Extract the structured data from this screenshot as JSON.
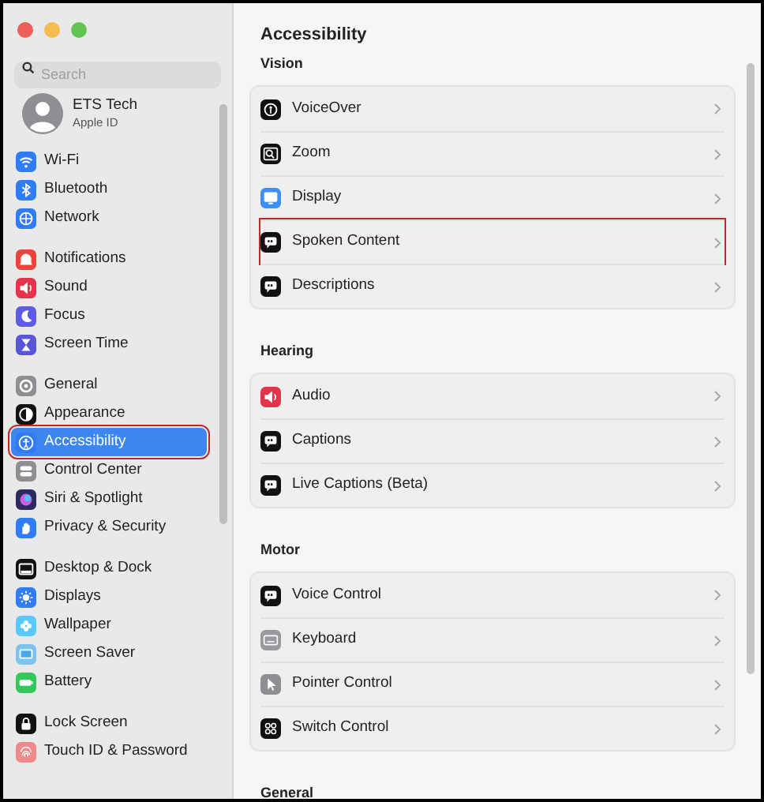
{
  "sidebar": {
    "search": {
      "placeholder": "Search"
    },
    "account": {
      "name": "ETS Tech",
      "subtitle": "Apple ID"
    },
    "groups": [
      {
        "items": [
          {
            "label": "Wi-Fi",
            "selected": false,
            "highlighted": false
          },
          {
            "label": "Bluetooth",
            "selected": false,
            "highlighted": false
          },
          {
            "label": "Network",
            "selected": false,
            "highlighted": false
          }
        ]
      },
      {
        "items": [
          {
            "label": "Notifications",
            "selected": false,
            "highlighted": false
          },
          {
            "label": "Sound",
            "selected": false,
            "highlighted": false
          },
          {
            "label": "Focus",
            "selected": false,
            "highlighted": false
          },
          {
            "label": "Screen Time",
            "selected": false,
            "highlighted": false
          }
        ]
      },
      {
        "items": [
          {
            "label": "General",
            "selected": false,
            "highlighted": false
          },
          {
            "label": "Appearance",
            "selected": false,
            "highlighted": false
          },
          {
            "label": "Accessibility",
            "selected": true,
            "highlighted": true
          },
          {
            "label": "Control Center",
            "selected": false,
            "highlighted": false
          },
          {
            "label": "Siri & Spotlight",
            "selected": false,
            "highlighted": false
          },
          {
            "label": "Privacy & Security",
            "selected": false,
            "highlighted": false
          }
        ]
      },
      {
        "items": [
          {
            "label": "Desktop & Dock",
            "selected": false,
            "highlighted": false
          },
          {
            "label": "Displays",
            "selected": false,
            "highlighted": false
          },
          {
            "label": "Wallpaper",
            "selected": false,
            "highlighted": false
          },
          {
            "label": "Screen Saver",
            "selected": false,
            "highlighted": false
          },
          {
            "label": "Battery",
            "selected": false,
            "highlighted": false
          }
        ]
      },
      {
        "items": [
          {
            "label": "Lock Screen",
            "selected": false,
            "highlighted": false
          },
          {
            "label": "Touch ID & Password",
            "selected": false,
            "highlighted": false
          }
        ]
      }
    ]
  },
  "content": {
    "title": "Accessibility",
    "sections": [
      {
        "heading": "Vision",
        "rows": [
          {
            "label": "VoiceOver",
            "highlighted": false
          },
          {
            "label": "Zoom",
            "highlighted": false
          },
          {
            "label": "Display",
            "highlighted": false
          },
          {
            "label": "Spoken Content",
            "highlighted": true
          },
          {
            "label": "Descriptions",
            "highlighted": false
          }
        ]
      },
      {
        "heading": "Hearing",
        "rows": [
          {
            "label": "Audio",
            "highlighted": false
          },
          {
            "label": "Captions",
            "highlighted": false
          },
          {
            "label": "Live Captions (Beta)",
            "highlighted": false
          }
        ]
      },
      {
        "heading": "Motor",
        "rows": [
          {
            "label": "Voice Control",
            "highlighted": false
          },
          {
            "label": "Keyboard",
            "highlighted": false
          },
          {
            "label": "Pointer Control",
            "highlighted": false
          },
          {
            "label": "Switch Control",
            "highlighted": false
          }
        ]
      },
      {
        "heading": "General"
      }
    ]
  }
}
